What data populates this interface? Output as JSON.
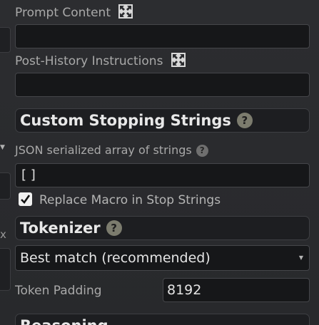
{
  "prompt_content": {
    "label": "Prompt Content",
    "value": ""
  },
  "post_history": {
    "label": "Post-History Instructions",
    "value": ""
  },
  "stopping": {
    "title": "Custom Stopping Strings",
    "json_label": "JSON serialized array of strings",
    "json_value": "[ ]",
    "replace_macro_label": "Replace Macro in Stop Strings",
    "replace_macro_checked": true
  },
  "tokenizer": {
    "title": "Tokenizer",
    "selected": "Best match (recommended)",
    "padding_label": "Token Padding",
    "padding_value": "8192"
  },
  "reasoning": {
    "title": "Reasoning"
  },
  "help_glyph": "?",
  "colors": {
    "background": "#2a2b2e",
    "input_bg": "#161719",
    "header_bg": "#1d1e21"
  }
}
